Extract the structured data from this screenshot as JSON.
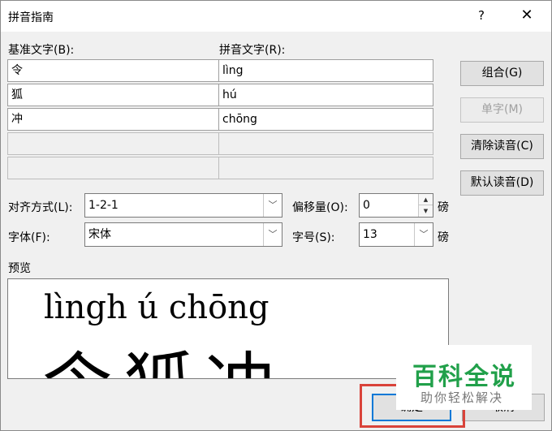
{
  "window": {
    "title": "拼音指南",
    "help": "?",
    "close": "✕"
  },
  "labels": {
    "base_text": "基准文字(B):",
    "pinyin_text": "拼音文字(R):"
  },
  "rows": [
    {
      "base": "令",
      "pinyin": "lìng"
    },
    {
      "base": "狐",
      "pinyin": "hú"
    },
    {
      "base": "冲",
      "pinyin": "chōng"
    },
    {
      "base": "",
      "pinyin": ""
    },
    {
      "base": "",
      "pinyin": ""
    }
  ],
  "buttons": {
    "combine": "组合(G)",
    "single": "单字(M)",
    "clear_reading": "清除读音(C)",
    "default_reading": "默认读音(D)",
    "ok": "确定",
    "cancel": "取消"
  },
  "options": {
    "align_label": "对齐方式(L):",
    "align_value": "1-2-1",
    "offset_label": "偏移量(O):",
    "offset_value": "0",
    "offset_unit": "磅",
    "font_label": "字体(F):",
    "font_value": "宋体",
    "size_label": "字号(S):",
    "size_value": "13",
    "size_unit": "磅"
  },
  "preview": {
    "label": "预览",
    "pinyin_line": "lìngh  ú chōng",
    "han_line": "令狐冲"
  },
  "watermark": {
    "title": "百科全说",
    "subtitle": "助你轻松解决"
  }
}
